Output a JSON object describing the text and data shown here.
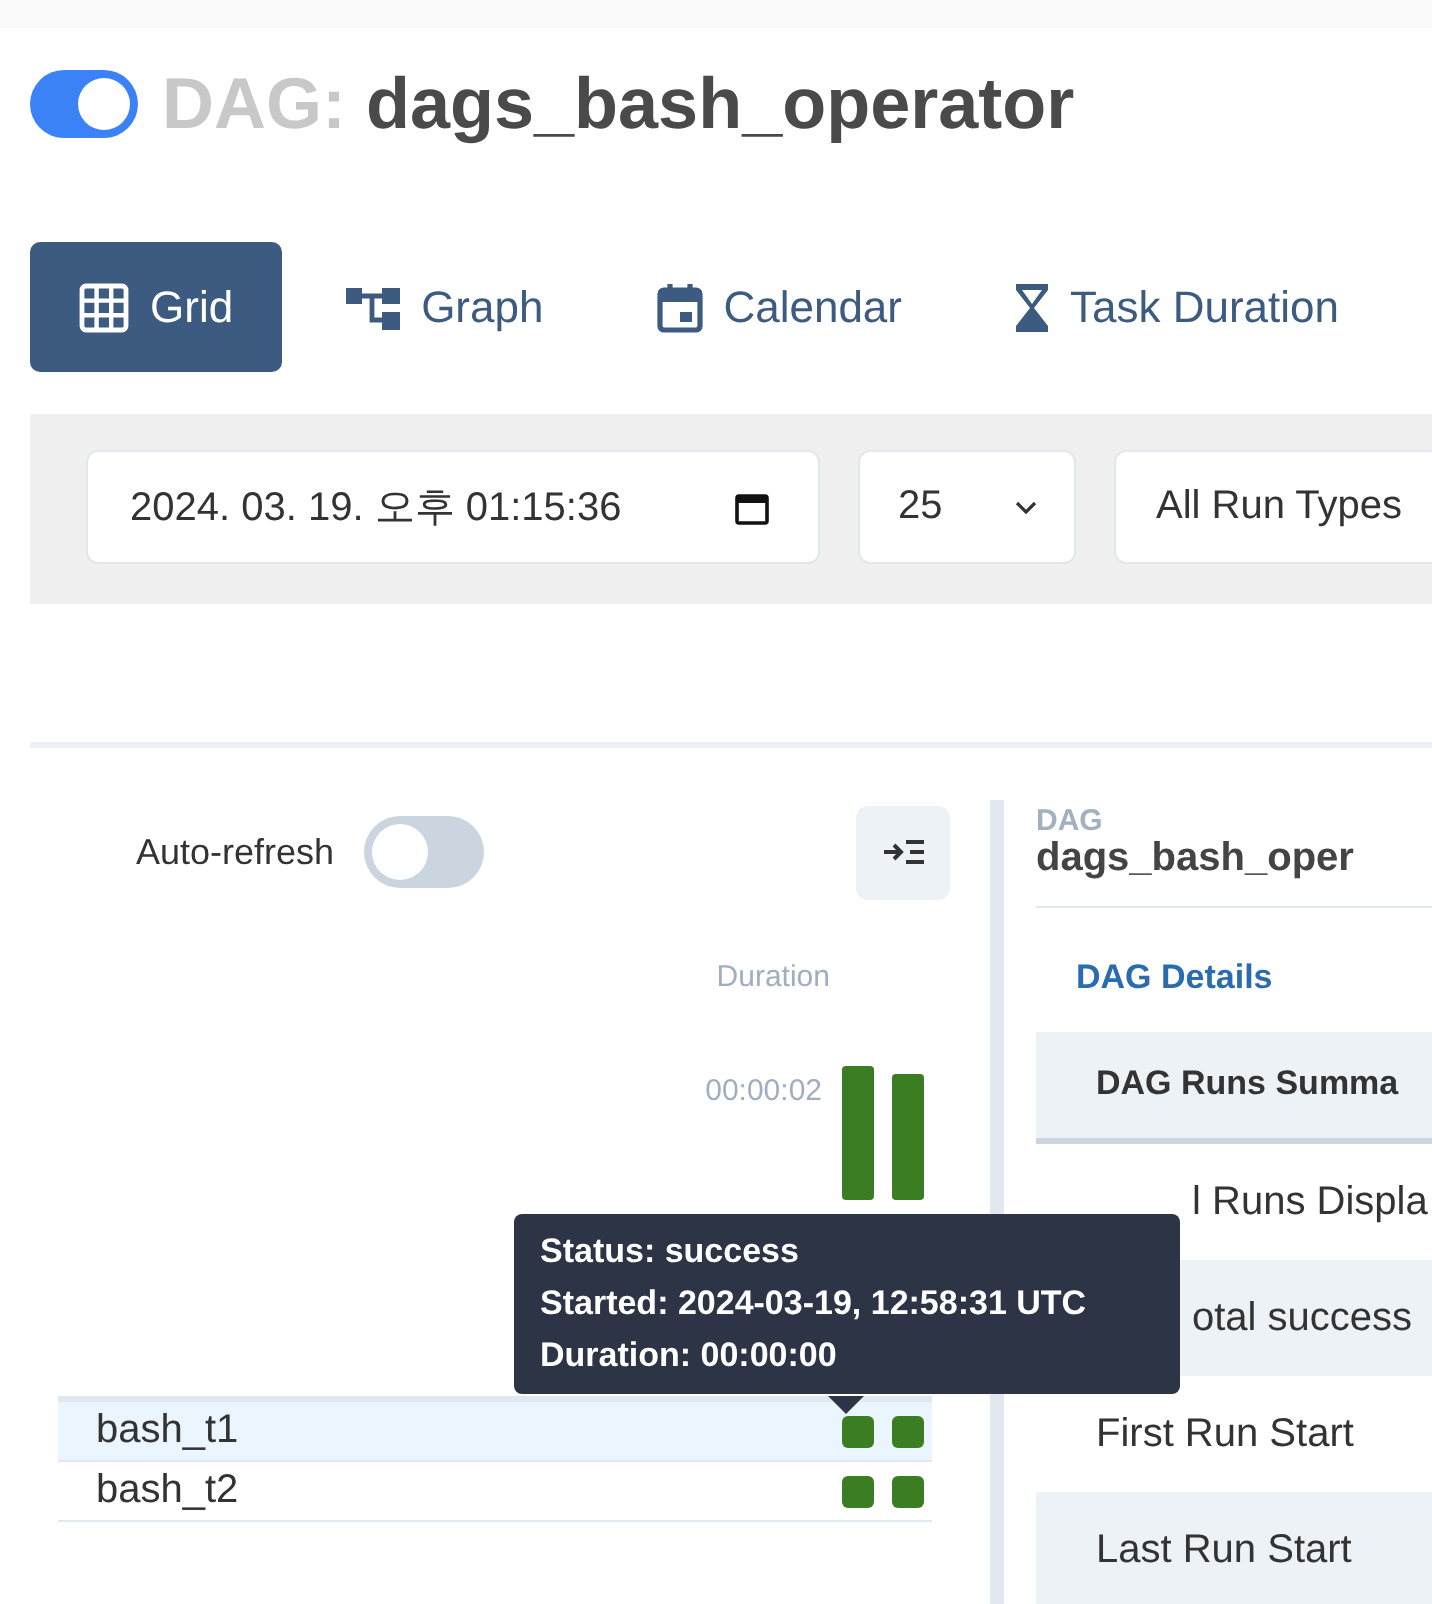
{
  "dag_toggle": {
    "on": true
  },
  "title": {
    "prefix": "DAG:",
    "name": "dags_bash_operator"
  },
  "tabs": [
    {
      "label": "Grid",
      "selected": true
    },
    {
      "label": "Graph",
      "selected": false
    },
    {
      "label": "Calendar",
      "selected": false
    },
    {
      "label": "Task Duration",
      "selected": false
    }
  ],
  "filters": {
    "date": "2024. 03. 19. 오후 01:15:36",
    "num_runs": "25",
    "run_type": "All Run Types"
  },
  "grid": {
    "auto_refresh": {
      "label": "Auto-refresh",
      "on": false
    },
    "duration_label": "Duration",
    "duration_tick": "00:00:02",
    "tasks": [
      {
        "name": "bash_t1",
        "selected": true,
        "runs": [
          {
            "color": "#3a7d22"
          },
          {
            "color": "#3a7d22"
          }
        ]
      },
      {
        "name": "bash_t2",
        "selected": false,
        "runs": [
          {
            "color": "#3a7d22"
          },
          {
            "color": "#3a7d22"
          }
        ]
      }
    ],
    "tooltip": [
      "Status: success",
      "Started: 2024-03-19, 12:58:31 UTC",
      "Duration: 00:00:00"
    ]
  },
  "details": {
    "caption": "DAG",
    "name": "dags_bash_oper",
    "tab": "DAG Details",
    "header": "DAG Runs Summa",
    "rows": [
      {
        "label": "l Runs Displa",
        "kind": "covered"
      },
      {
        "label": "otal success",
        "kind": "covered"
      },
      {
        "label": "First Run Start",
        "kind": "full"
      },
      {
        "label": "Last Run Start",
        "kind": "full"
      }
    ]
  }
}
